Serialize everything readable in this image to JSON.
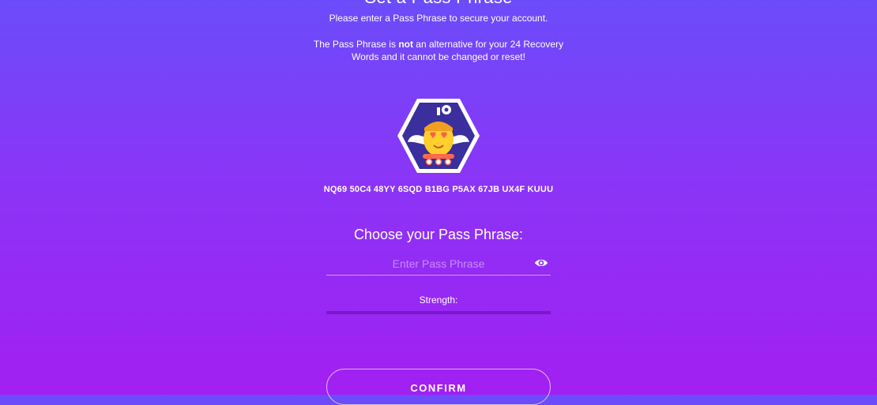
{
  "header": {
    "title": "Set a Pass Phrase",
    "subtitle": "Please enter a Pass Phrase to secure your account."
  },
  "warning": {
    "prefix": "The Pass Phrase is ",
    "emphasis": "not",
    "suffix": " an alternative for your 24 Recovery Words and it cannot be changed or reset!"
  },
  "account": {
    "identicon_icon": "robot-identicon-icon",
    "address": "NQ69 50C4 48YY 6SQD B1BG P5AX 67JB UX4F KUUU"
  },
  "form": {
    "choose_label": "Choose your Pass Phrase:",
    "input_value": "",
    "input_placeholder": "Enter Pass Phrase",
    "toggle_icon": "eye-icon",
    "strength_label": "Strength:",
    "strength_value": 0,
    "confirm_label": "CONFIRM"
  },
  "colors": {
    "gradient_top": "#6b4cfb",
    "gradient_bottom": "#a21ff2",
    "identicon_bg": "#3a2f9c",
    "text": "#ffffff"
  }
}
